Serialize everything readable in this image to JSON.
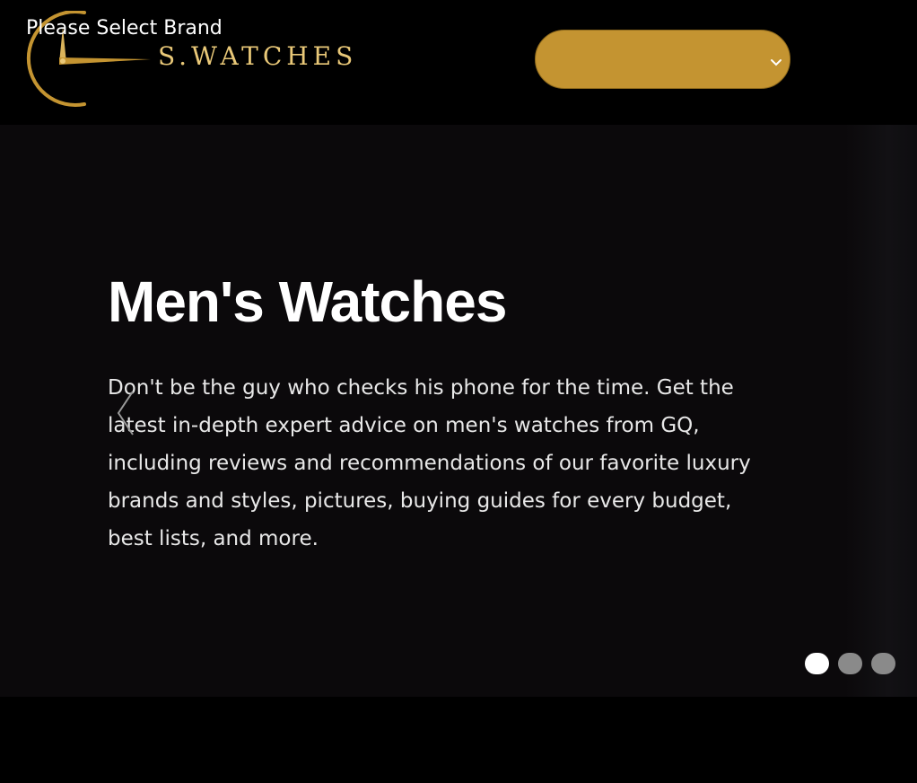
{
  "header": {
    "brand_name": "S.WATCHES",
    "logo_icon": "watch-logo-icon",
    "brand_select": {
      "label": "Please Select Brand",
      "icon": "chevron-down-icon"
    }
  },
  "hero": {
    "title": "Men's Watches",
    "description": "Don't be the guy who checks his phone for the time. Get the latest in-depth expert advice on men's watches from GQ, including reviews and recommendations of our favorite luxury brands and styles, pictures, buying guides for every budget, best lists, and more.",
    "prev_icon": "chevron-left-icon",
    "slides_count": 3,
    "active_slide": 1
  },
  "colors": {
    "gold": "#c49431",
    "brand_text": "#e9c878",
    "background": "#000000",
    "hero_background": "#0b090b"
  }
}
